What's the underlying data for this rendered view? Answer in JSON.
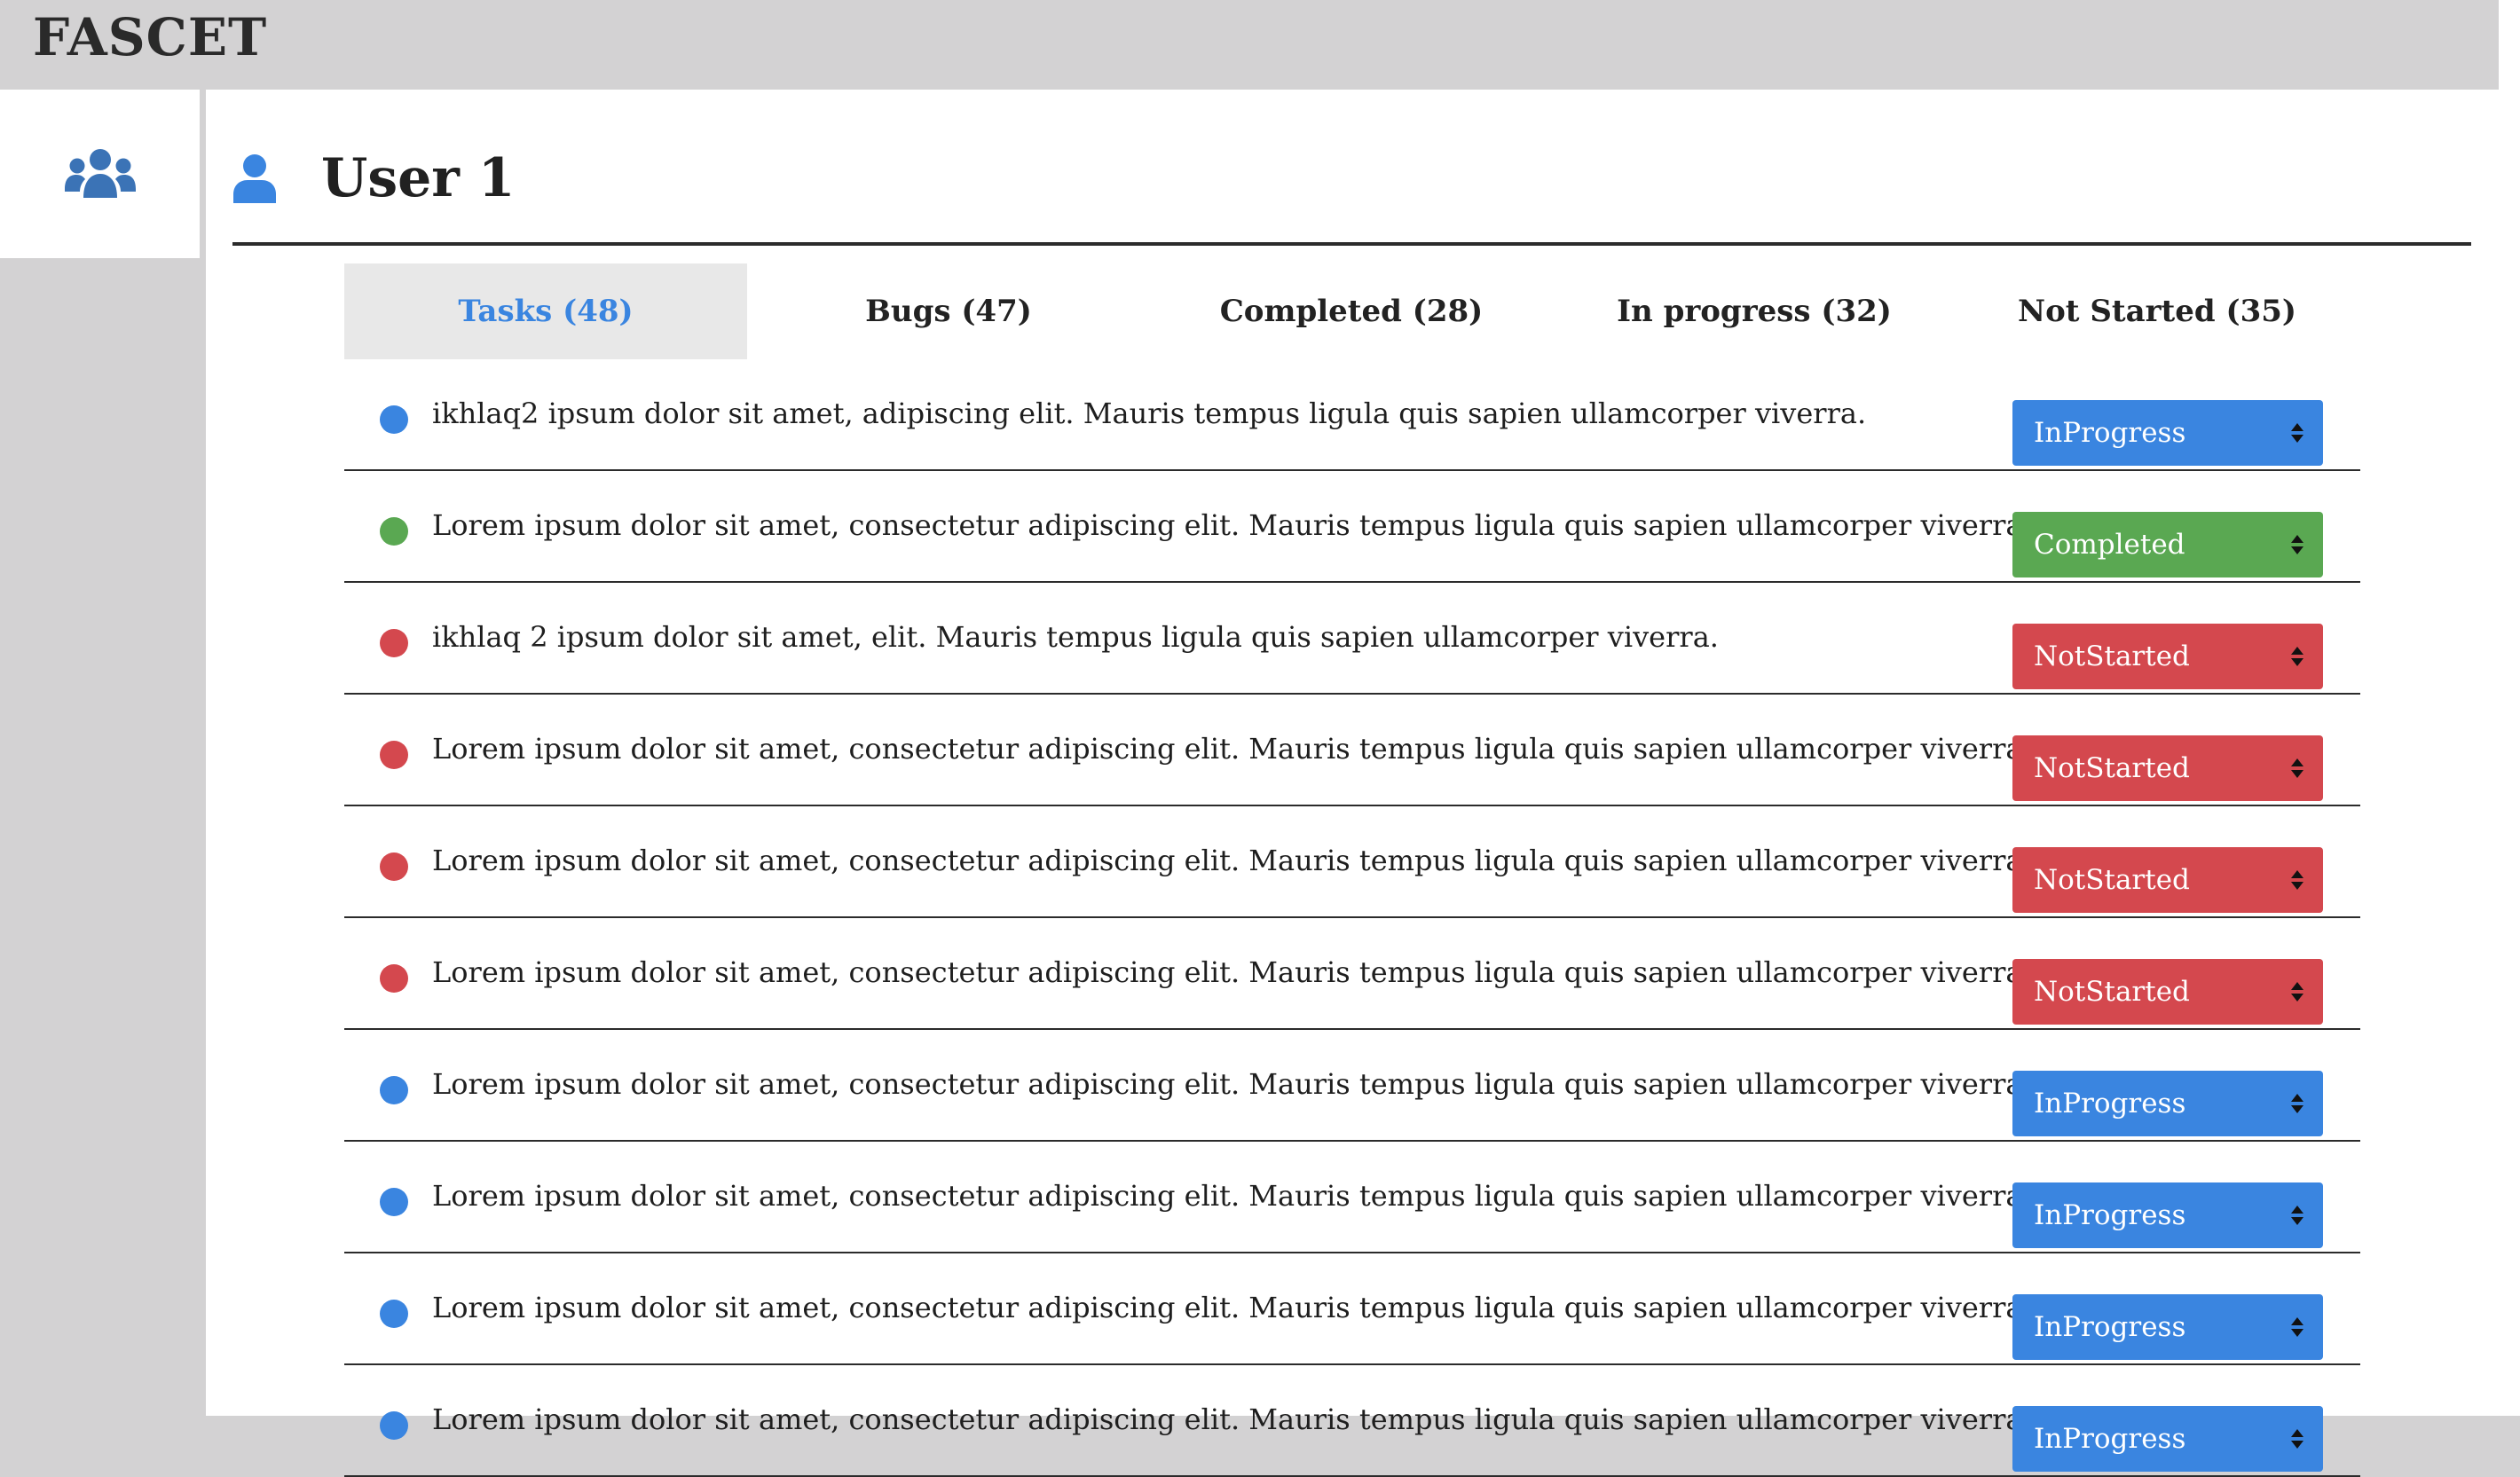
{
  "app": {
    "title": "FASCET"
  },
  "sidebar": {
    "icon": "users-icon"
  },
  "user": {
    "name": "User 1",
    "icon": "user-icon"
  },
  "tabs": [
    {
      "label": "Tasks (48)",
      "active": true
    },
    {
      "label": "Bugs (47)",
      "active": false
    },
    {
      "label": "Completed (28)",
      "active": false
    },
    {
      "label": "In progress (32)",
      "active": false
    },
    {
      "label": "Not Started (35)",
      "active": false
    }
  ],
  "colors": {
    "InProgress": "#3a85e0",
    "Completed": "#5aa852",
    "NotStarted": "#d4484e",
    "user_icon": "#3a85e0",
    "sidebar_icon": "#3b73b6"
  },
  "tasks": [
    {
      "text": "ikhlaq2 ipsum dolor sit amet, adipiscing elit. Mauris tempus ligula quis sapien ullamcorper viverra.",
      "status": "InProgress"
    },
    {
      "text": "Lorem ipsum dolor sit amet, consectetur adipiscing elit. Mauris tempus ligula quis sapien ullamcorper viverra.",
      "status": "Completed"
    },
    {
      "text": "ikhlaq 2 ipsum dolor sit amet, elit. Mauris tempus ligula quis sapien ullamcorper viverra.",
      "status": "NotStarted"
    },
    {
      "text": "Lorem ipsum dolor sit amet, consectetur adipiscing elit. Mauris tempus ligula quis sapien ullamcorper viverra.",
      "status": "NotStarted"
    },
    {
      "text": "Lorem ipsum dolor sit amet, consectetur adipiscing elit. Mauris tempus ligula quis sapien ullamcorper viverra.",
      "status": "NotStarted"
    },
    {
      "text": "Lorem ipsum dolor sit amet, consectetur adipiscing elit. Mauris tempus ligula quis sapien ullamcorper viverra.",
      "status": "NotStarted"
    },
    {
      "text": "Lorem ipsum dolor sit amet, consectetur adipiscing elit. Mauris tempus ligula quis sapien ullamcorper viverra.",
      "status": "InProgress"
    },
    {
      "text": "Lorem ipsum dolor sit amet, consectetur adipiscing elit. Mauris tempus ligula quis sapien ullamcorper viverra.",
      "status": "InProgress"
    },
    {
      "text": "Lorem ipsum dolor sit amet, consectetur adipiscing elit. Mauris tempus ligula quis sapien ullamcorper viverra.",
      "status": "InProgress"
    },
    {
      "text": "Lorem ipsum dolor sit amet, consectetur adipiscing elit. Mauris tempus ligula quis sapien ullamcorper viverra.",
      "status": "InProgress"
    }
  ]
}
